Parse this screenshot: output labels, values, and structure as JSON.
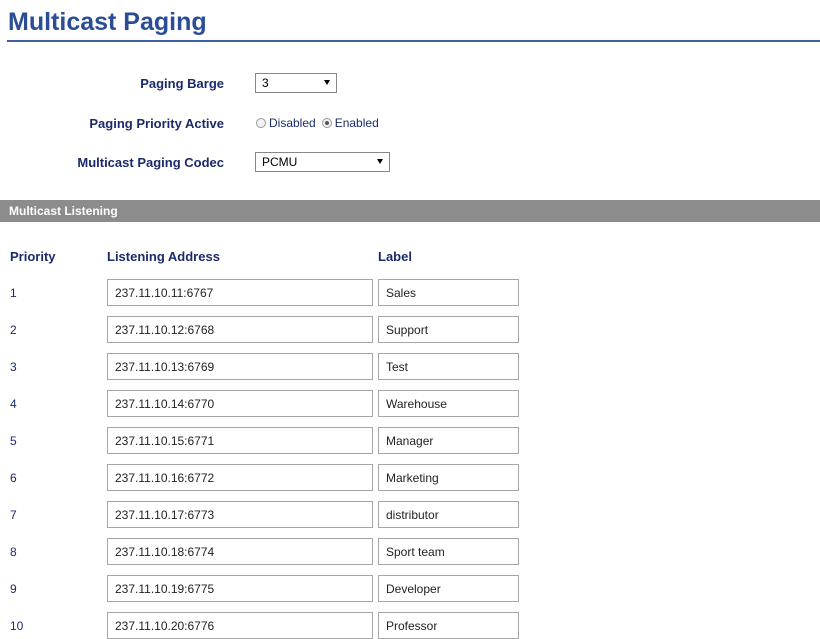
{
  "page_title": "Multicast Paging",
  "form": {
    "paging_barge": {
      "label": "Paging Barge",
      "value": "3"
    },
    "paging_priority_active": {
      "label": "Paging Priority Active",
      "options": [
        "Disabled",
        "Enabled"
      ],
      "selected": "Enabled"
    },
    "multicast_paging_codec": {
      "label": "Multicast Paging Codec",
      "value": "PCMU"
    }
  },
  "section": {
    "title": "Multicast Listening",
    "columns": {
      "priority": "Priority",
      "address": "Listening Address",
      "label": "Label"
    },
    "rows": [
      {
        "priority": "1",
        "address": "237.11.10.11:6767",
        "label": "Sales"
      },
      {
        "priority": "2",
        "address": "237.11.10.12:6768",
        "label": "Support"
      },
      {
        "priority": "3",
        "address": "237.11.10.13:6769",
        "label": "Test"
      },
      {
        "priority": "4",
        "address": "237.11.10.14:6770",
        "label": "Warehouse"
      },
      {
        "priority": "5",
        "address": "237.11.10.15:6771",
        "label": "Manager"
      },
      {
        "priority": "6",
        "address": "237.11.10.16:6772",
        "label": "Marketing"
      },
      {
        "priority": "7",
        "address": "237.11.10.17:6773",
        "label": "distributor"
      },
      {
        "priority": "8",
        "address": "237.11.10.18:6774",
        "label": "Sport team"
      },
      {
        "priority": "9",
        "address": "237.11.10.19:6775",
        "label": "Developer"
      },
      {
        "priority": "10",
        "address": "237.11.10.20:6776",
        "label": "Professor"
      }
    ]
  },
  "colors": {
    "title": "#2a4d96",
    "label_text": "#1c2a6b",
    "section_bar": "#8c8c8c"
  }
}
